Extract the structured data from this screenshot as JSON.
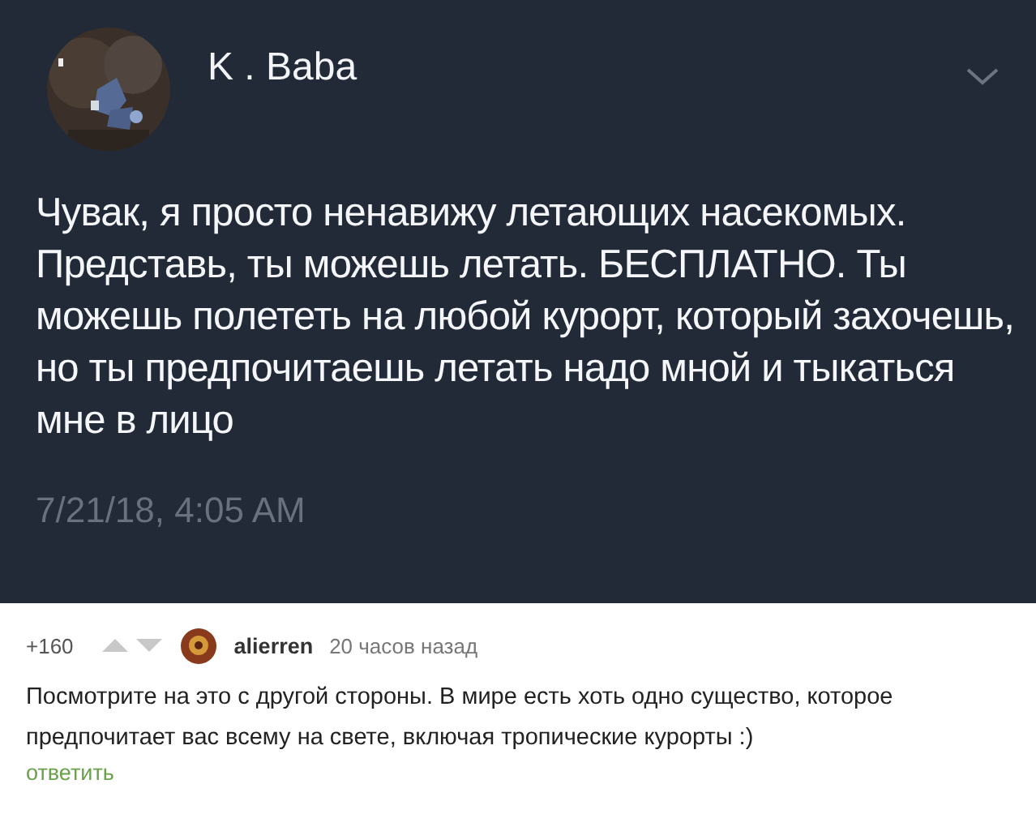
{
  "tweet": {
    "author": "K . Baba",
    "text": "Чувак, я просто ненавижу летающих насекомых. Представь, ты можешь летать. БЕСПЛАТНО. Ты можешь полететь на любой курорт, который захочешь, но ты предпочитаешь летать надо мной и тыкаться мне в лицо",
    "timestamp": "7/21/18, 4:05 AM"
  },
  "comment": {
    "rating": "+160",
    "author": "alierren",
    "time": "20 часов назад",
    "text": "Посмотрите на это с другой стороны. В мире есть хоть одно существо, которое предпочитает вас всему на свете, включая тропические курорты :)",
    "reply": "ответить"
  }
}
